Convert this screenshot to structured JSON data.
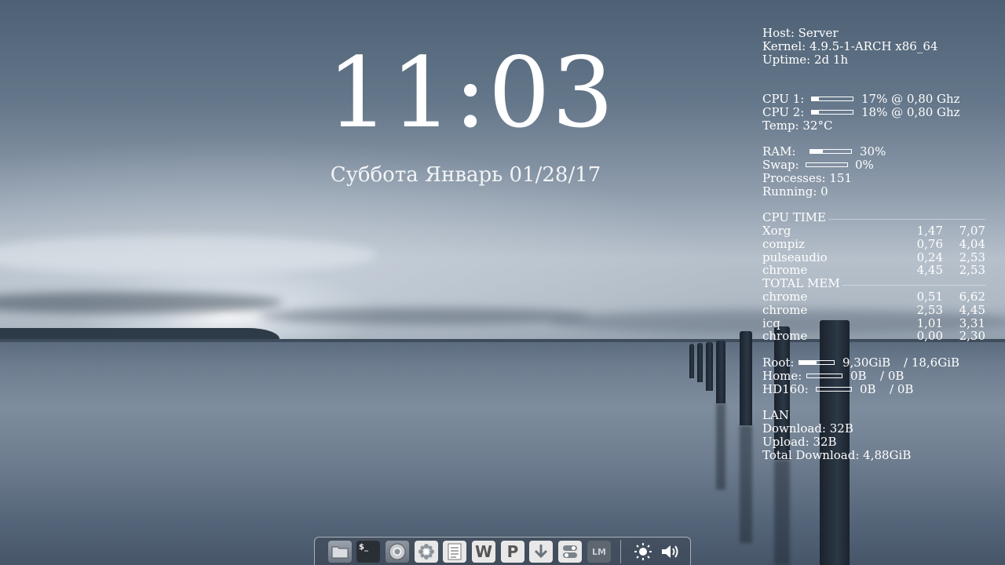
{
  "clock": {
    "time": "11:03",
    "date": "Суббота Январь 01/28/17"
  },
  "system": {
    "host": "Host: Server",
    "kernel": "Kernel: 4.9.5-1-ARCH x86_64",
    "uptime": "Uptime: 2d 1h"
  },
  "cpu": {
    "cpu1": {
      "label": "CPU 1:",
      "value": "17% @ 0,80 Ghz",
      "percent": 17
    },
    "cpu2": {
      "label": "CPU 2:",
      "value": "18% @ 0,80 Ghz",
      "percent": 18
    },
    "temp": "Temp: 32°C"
  },
  "memory": {
    "ram": {
      "label": "RAM:",
      "value": "30%",
      "percent": 30
    },
    "swap": {
      "label": "Swap:",
      "value": "0%",
      "percent": 0
    },
    "processes": "Processes: 151",
    "running": "Running: 0"
  },
  "cpu_time": {
    "header": "CPU TIME",
    "rows": [
      {
        "name": "Xorg",
        "v1": "1,47",
        "v2": "7,07"
      },
      {
        "name": "compiz",
        "v1": "0,76",
        "v2": "4,04"
      },
      {
        "name": "pulseaudio",
        "v1": "0,24",
        "v2": "2,53"
      },
      {
        "name": "chrome",
        "v1": "4,45",
        "v2": "2,53"
      }
    ]
  },
  "total_mem": {
    "header": "TOTAL MEM",
    "rows": [
      {
        "name": "chrome",
        "v1": "0,51",
        "v2": "6,62"
      },
      {
        "name": "chrome",
        "v1": "2,53",
        "v2": "4,45"
      },
      {
        "name": "icq",
        "v1": "1,01",
        "v2": "3,31"
      },
      {
        "name": "chrome",
        "v1": "0,00",
        "v2": "2,30"
      }
    ]
  },
  "disks": {
    "root": {
      "label": "Root:",
      "used": "9,30GiB",
      "total": "/ 18,6GiB",
      "percent": 50
    },
    "home": {
      "label": "Home:",
      "used": "0B",
      "total": "/ 0B",
      "percent": 0
    },
    "hd160": {
      "label": "HD160:",
      "used": "0B",
      "total": "/ 0B",
      "percent": 0
    }
  },
  "network": {
    "title": "LAN",
    "download": "Download: 32B",
    "upload": "Upload: 32B",
    "total_download": "Total Download: 4,88GiB"
  },
  "dock": {
    "terminal_glyph": "$_",
    "writer_glyph": "W",
    "presentation_glyph": "P",
    "lm_glyph": "LM",
    "icons": [
      "folder-icon",
      "terminal-icon",
      "chrome-icon",
      "pinwheel-icon",
      "text-editor-icon",
      "writer-icon",
      "presentation-icon",
      "download-icon",
      "settings-icon",
      "lm-icon",
      "brightness-icon",
      "volume-icon"
    ]
  },
  "colors": {
    "text": "#ffffff",
    "dock_bg": "#3c4652",
    "icon_bg": "#e8e8e8"
  }
}
